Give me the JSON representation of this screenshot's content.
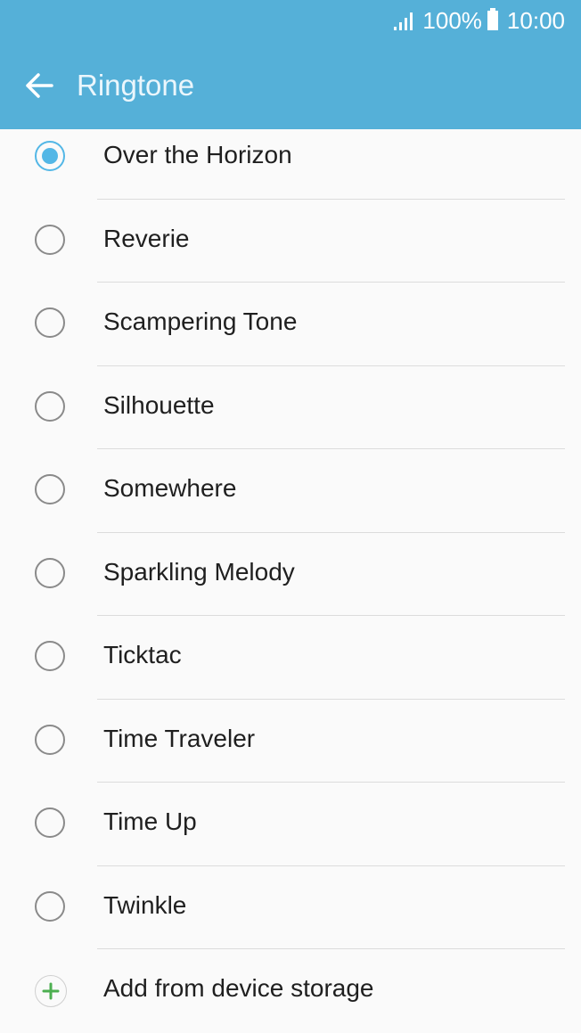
{
  "status_bar": {
    "battery_percent": "100%",
    "time": "10:00",
    "icons": [
      "signal-icon",
      "battery-icon"
    ]
  },
  "app_bar": {
    "title": "Ringtone",
    "back_icon": "back-arrow-icon"
  },
  "ringtones": {
    "selected_index": 0,
    "items": [
      {
        "label": "Over the Horizon",
        "selected": true
      },
      {
        "label": "Reverie",
        "selected": false
      },
      {
        "label": "Scampering Tone",
        "selected": false
      },
      {
        "label": "Silhouette",
        "selected": false
      },
      {
        "label": "Somewhere",
        "selected": false
      },
      {
        "label": "Sparkling Melody",
        "selected": false
      },
      {
        "label": "Ticktac",
        "selected": false
      },
      {
        "label": "Time Traveler",
        "selected": false
      },
      {
        "label": "Time Up",
        "selected": false
      },
      {
        "label": "Twinkle",
        "selected": false
      }
    ]
  },
  "add_action": {
    "label": "Add from device storage",
    "icon": "plus-icon"
  },
  "colors": {
    "header": "#55b0d8",
    "accent": "#53b7e6",
    "add_icon": "#4caf50"
  }
}
